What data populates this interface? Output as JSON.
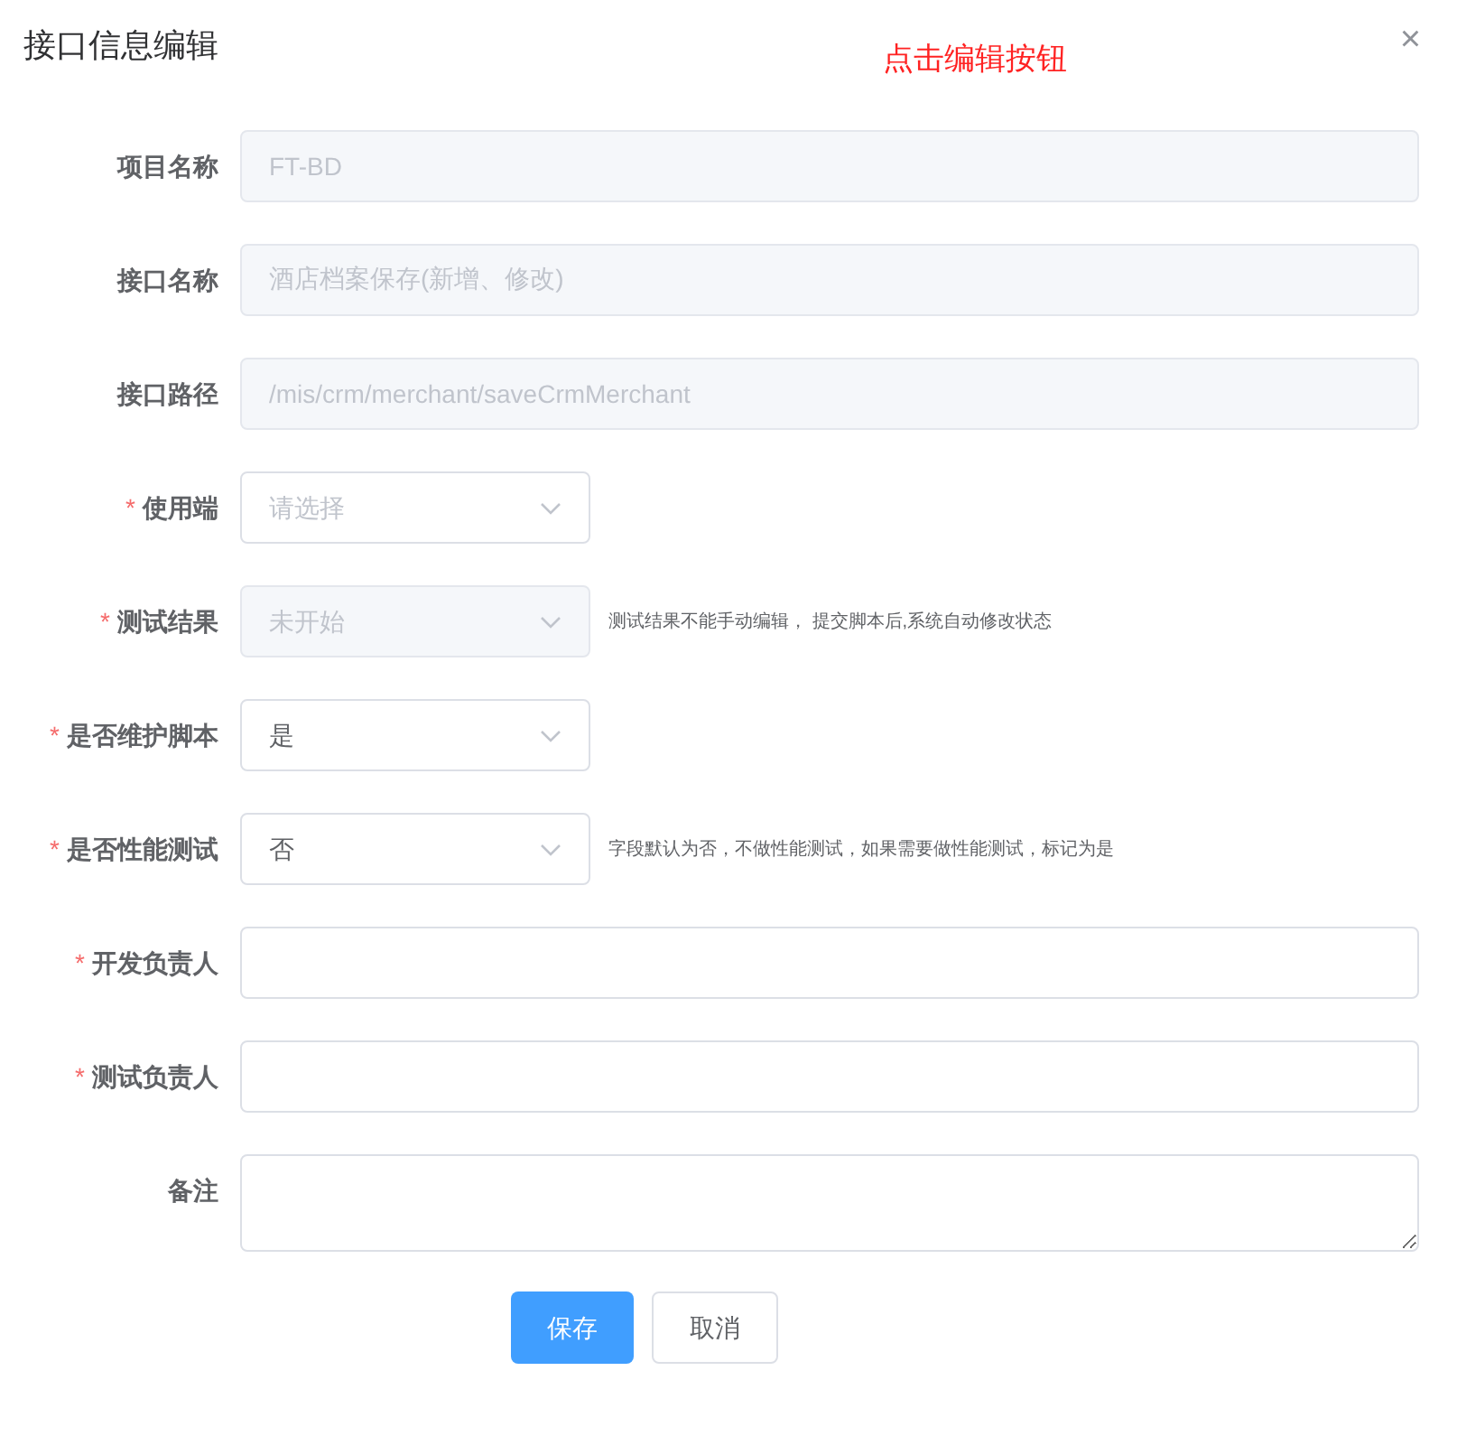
{
  "dialog": {
    "title": "接口信息编辑",
    "annotation": "点击编辑按钮",
    "close": "×"
  },
  "fields": [
    {
      "label": "项目名称",
      "kind": "input",
      "disabled": true,
      "value": "FT-BD"
    },
    {
      "label": "接口名称",
      "kind": "input",
      "disabled": true,
      "value": "酒店档案保存(新增、修改)"
    },
    {
      "label": "接口路径",
      "kind": "input",
      "disabled": true,
      "value": "/mis/crm/merchant/saveCrmMerchant"
    },
    {
      "label": "使用端",
      "required_mark": "*",
      "kind": "select",
      "placeholder": "请选择"
    },
    {
      "label": "测试结果",
      "required_mark": "*",
      "kind": "select",
      "disabled": true,
      "value": "未开始",
      "hint": "测试结果不能手动编辑， 提交脚本后,系统自动修改状态"
    },
    {
      "label": "是否维护脚本",
      "required_mark": "*",
      "kind": "select",
      "value": "是"
    },
    {
      "label": "是否性能测试",
      "required_mark": "*",
      "kind": "select",
      "value": "否",
      "hint": "字段默认为否，不做性能测试，如果需要做性能测试，标记为是"
    },
    {
      "label": "开发负责人",
      "required_mark": "*",
      "kind": "input"
    },
    {
      "label": "测试负责人",
      "required_mark": "*",
      "kind": "input"
    },
    {
      "label": "备注",
      "kind": "textarea"
    }
  ],
  "buttons": [
    {
      "label": "保存",
      "kind": "primary"
    },
    {
      "label": "取消",
      "kind": "default"
    }
  ]
}
